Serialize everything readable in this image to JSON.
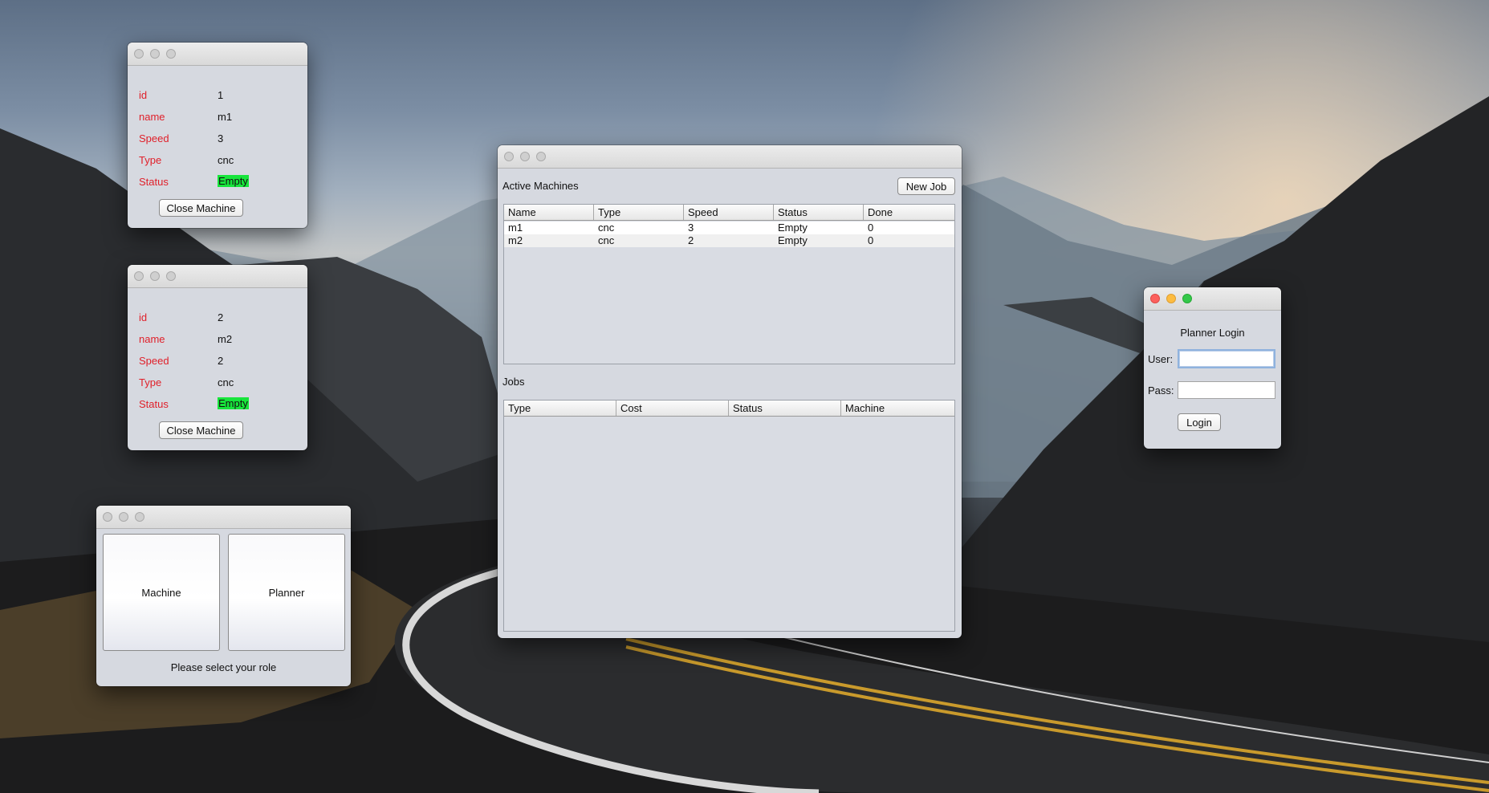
{
  "machine_windows": [
    {
      "fields": [
        {
          "label": "id",
          "value": "1"
        },
        {
          "label": "name",
          "value": "m1"
        },
        {
          "label": "Speed",
          "value": "3"
        },
        {
          "label": "Type",
          "value": "cnc"
        },
        {
          "label": "Status",
          "value": "Empty"
        }
      ],
      "close_button": "Close Machine"
    },
    {
      "fields": [
        {
          "label": "id",
          "value": "2"
        },
        {
          "label": "name",
          "value": "m2"
        },
        {
          "label": "Speed",
          "value": "2"
        },
        {
          "label": "Type",
          "value": "cnc"
        },
        {
          "label": "Status",
          "value": "Empty"
        }
      ],
      "close_button": "Close Machine"
    }
  ],
  "planner_window": {
    "active_machines_label": "Active Machines",
    "new_job_button": "New Job",
    "machines_table": {
      "columns": [
        "Name",
        "Type",
        "Speed",
        "Status",
        "Done"
      ],
      "rows": [
        [
          "m1",
          "cnc",
          "3",
          "Empty",
          "0"
        ],
        [
          "m2",
          "cnc",
          "2",
          "Empty",
          "0"
        ]
      ]
    },
    "jobs_label": "Jobs",
    "jobs_table": {
      "columns": [
        "Type",
        "Cost",
        "Status",
        "Machine"
      ],
      "rows": []
    }
  },
  "role_window": {
    "machine_button": "Machine",
    "planner_button": "Planner",
    "prompt": "Please select your role"
  },
  "login_window": {
    "title": "Planner Login",
    "user_label": "User:",
    "user_value": "",
    "pass_label": "Pass:",
    "pass_value": "",
    "login_button": "Login"
  },
  "colors": {
    "label_red": "#e0202a",
    "status_empty_green": "#17e53b",
    "window_bg": "#d6d9e0"
  }
}
